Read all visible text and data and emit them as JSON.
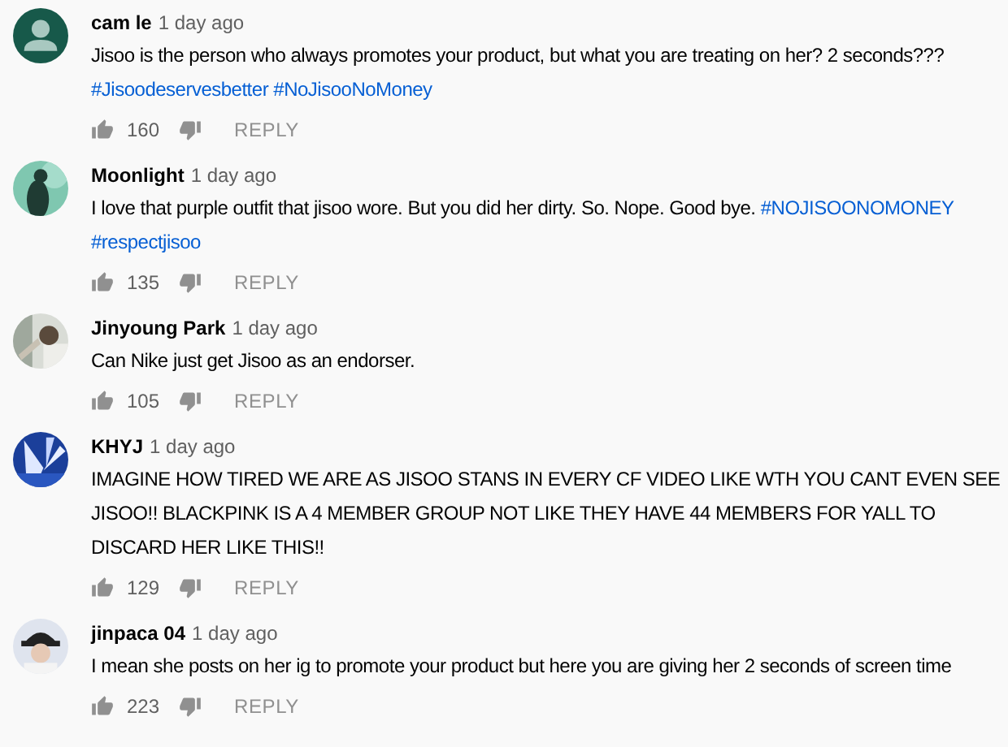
{
  "comments": [
    {
      "author": "cam le",
      "time": "1 day ago",
      "avatar": {
        "kind": "default"
      },
      "body": [
        {
          "kind": "text",
          "text": "Jisoo is the person who always promotes your product, but what you are treating on her? 2 seconds???"
        },
        {
          "kind": "hashtag",
          "text": "#Jisoodeservesbetter"
        },
        {
          "kind": "hashtag",
          "text": "#NoJisooNoMoney"
        }
      ],
      "likes": "160",
      "reply": "REPLY"
    },
    {
      "author": "Moonlight",
      "time": "1 day ago",
      "body": [
        {
          "kind": "text",
          "text": "I love that purple outfit that jisoo wore. But you did her dirty. So. Nope. Good bye."
        },
        {
          "kind": "hashtag",
          "text": "#NOJISOONOMONEY"
        },
        {
          "kind": "hashtag",
          "text": "#respectjisoo"
        }
      ],
      "likes": "135",
      "reply": "REPLY"
    },
    {
      "author": "Jinyoung Park",
      "time": "1 day ago",
      "body": [
        {
          "kind": "text",
          "text": "Can Nike just get Jisoo as an endorser."
        }
      ],
      "likes": "105",
      "reply": "REPLY"
    },
    {
      "author": "KHYJ",
      "time": "1 day ago",
      "body": [
        {
          "kind": "text",
          "text": "IMAGINE HOW TIRED WE ARE AS JISOO STANS IN EVERY CF VIDEO LIKE WTH YOU CANT EVEN SEE JISOO!! BLACKPINK IS A 4 MEMBER GROUP NOT LIKE THEY HAVE 44 MEMBERS FOR YALL TO DISCARD HER LIKE THIS!!"
        }
      ],
      "likes": "129",
      "reply": "REPLY"
    },
    {
      "author": "jinpaca 04",
      "time": "1 day ago",
      "body": [
        {
          "kind": "text",
          "text": "I mean she posts on her ig to promote your product but here you are giving her 2 seconds of screen time"
        }
      ],
      "likes": "223",
      "reply": "REPLY"
    }
  ]
}
